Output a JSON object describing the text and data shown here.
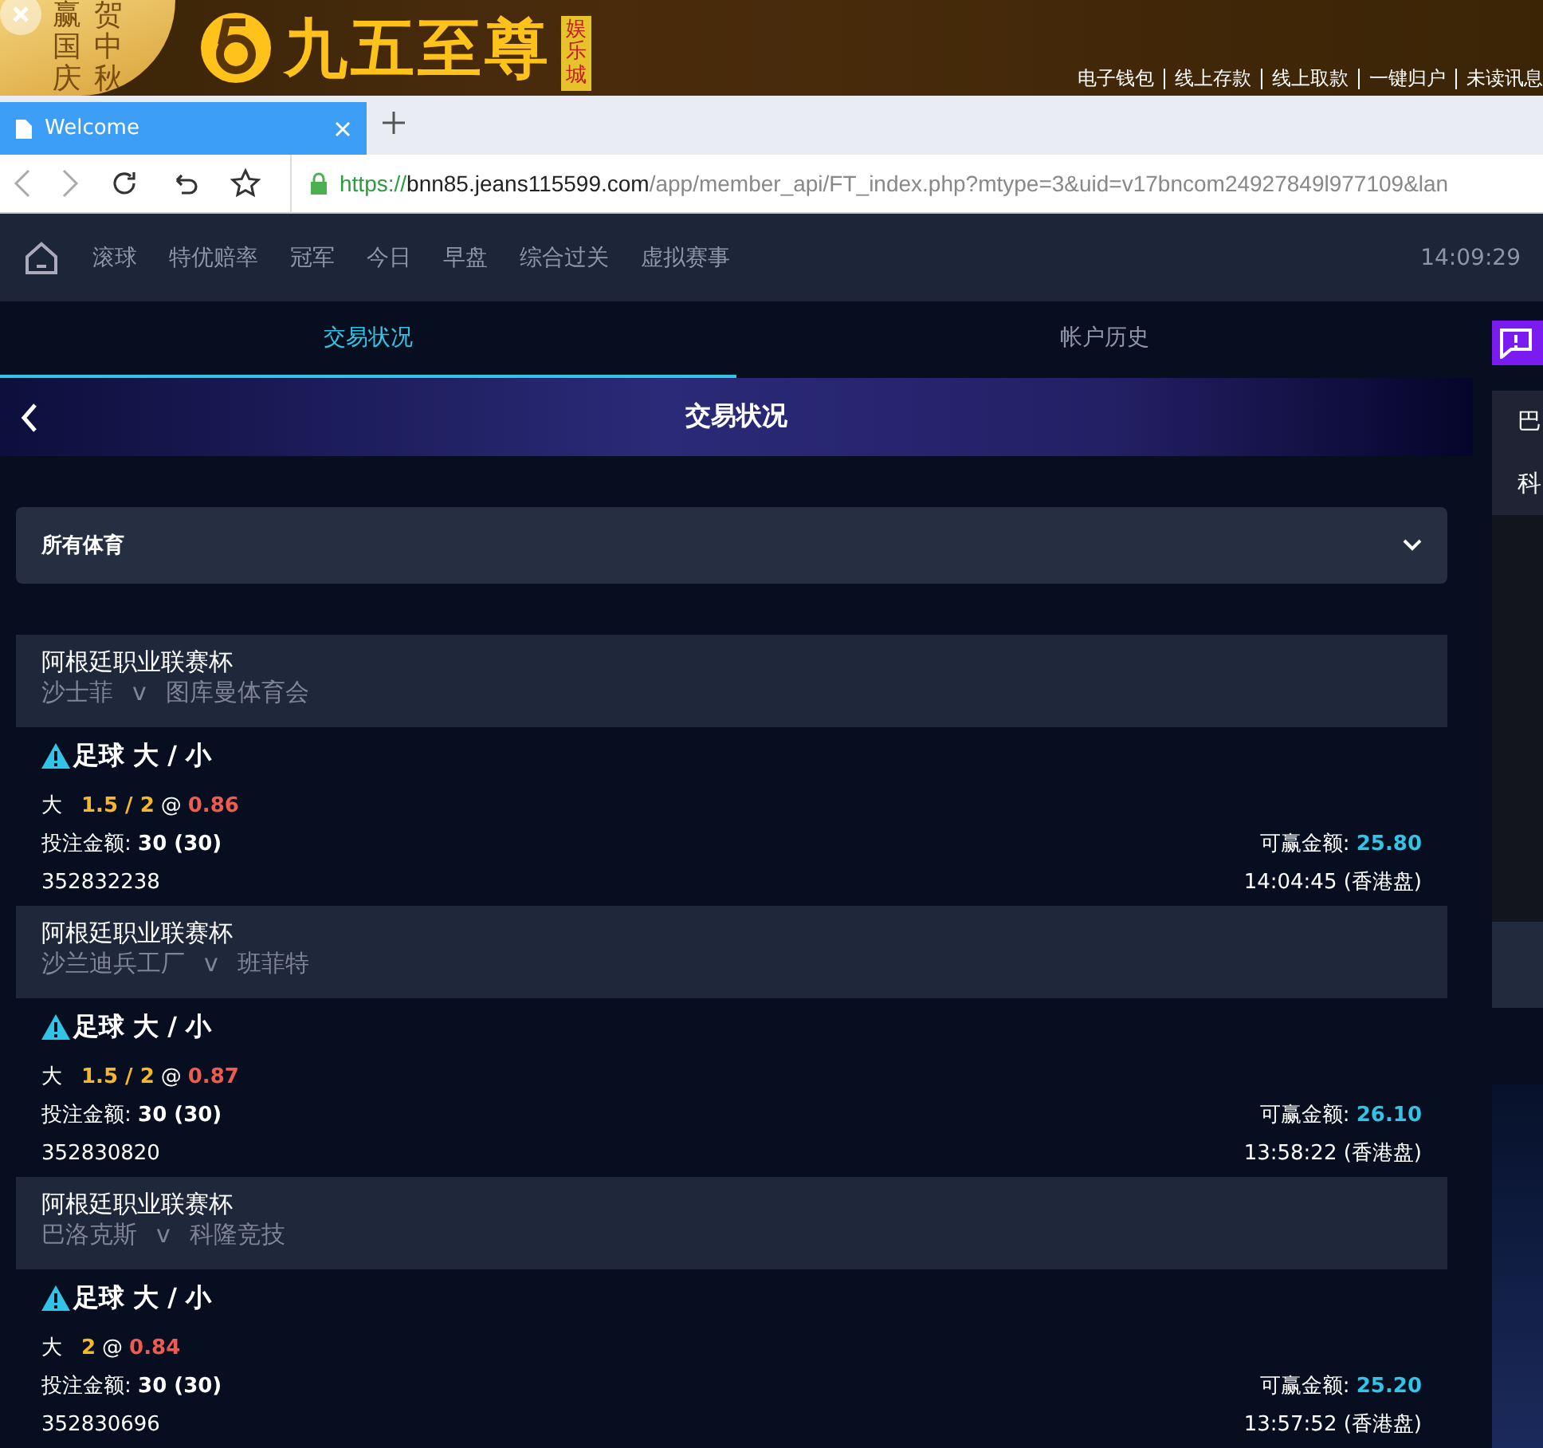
{
  "banner": {
    "promo_columns": [
      "赢国庆",
      "贺中秋"
    ],
    "logo": "九五至尊",
    "logo_badge": "娱乐城",
    "links": [
      "电子钱包",
      "线上存款",
      "线上取款",
      "一键归户",
      "未读讯息"
    ]
  },
  "browser": {
    "tab_title": "Welcome",
    "url_scheme": "https://",
    "url_host": "bnn85.jeans115599.com",
    "url_path": "/app/member_api/FT_index.php?mtype=3&uid=v17bncom24927849l977109&lan"
  },
  "nav": {
    "items": [
      "滚球",
      "特优赔率",
      "冠军",
      "今日",
      "早盘",
      "综合过关",
      "虚拟赛事"
    ],
    "time": "14:09:29"
  },
  "tabs": [
    {
      "label": "交易状况",
      "selected": true
    },
    {
      "label": "帐户历史",
      "selected": false
    }
  ],
  "header": {
    "title": "交易状况"
  },
  "filter": {
    "value": "所有体育"
  },
  "bets": [
    {
      "league": "阿根廷职业联赛杯",
      "home": "沙士菲",
      "vs": "v",
      "away": "图库曼体育会",
      "market": "足球 大 / 小",
      "side": "大",
      "line": "1.5 / 2",
      "at": "@",
      "odds": "0.86",
      "stake_label": "投注金额:",
      "stake": "30 (30)",
      "win_label": "可赢金额:",
      "win": "25.80",
      "ticket": "352832238",
      "time": "14:04:45 (香港盘)"
    },
    {
      "league": "阿根廷职业联赛杯",
      "home": "沙兰迪兵工厂",
      "vs": "v",
      "away": "班菲特",
      "market": "足球 大 / 小",
      "side": "大",
      "line": "1.5 / 2",
      "at": "@",
      "odds": "0.87",
      "stake_label": "投注金额:",
      "stake": "30 (30)",
      "win_label": "可赢金额:",
      "win": "26.10",
      "ticket": "352830820",
      "time": "13:58:22 (香港盘)"
    },
    {
      "league": "阿根廷职业联赛杯",
      "home": "巴洛克斯",
      "vs": "v",
      "away": "科隆竞技",
      "market": "足球 大 / 小",
      "side": "大",
      "line": "2",
      "at": "@",
      "odds": "0.84",
      "stake_label": "投注金额:",
      "stake": "30 (30)",
      "win_label": "可赢金额:",
      "win": "25.20",
      "ticket": "352830696",
      "time": "13:57:52 (香港盘)"
    }
  ],
  "side_panel": {
    "lines": [
      "巴",
      "科"
    ]
  }
}
